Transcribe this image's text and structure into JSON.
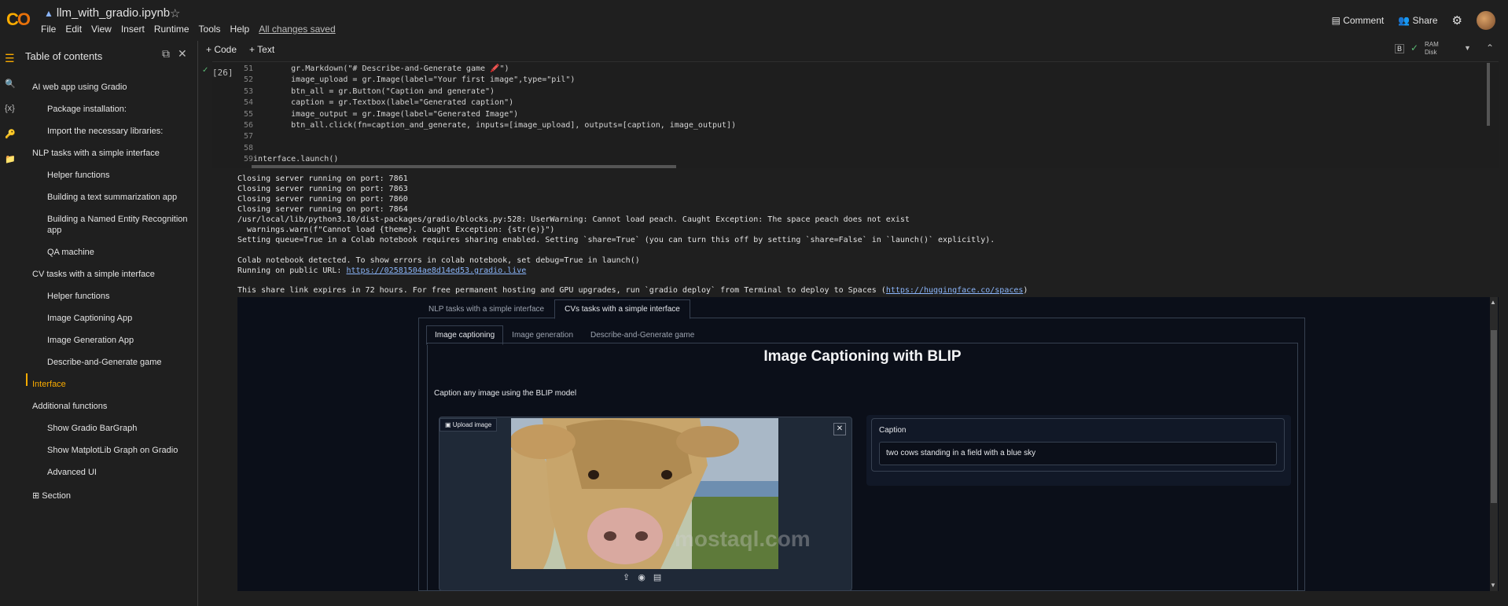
{
  "app": {
    "notebook_title": "llm_with_gradio.ipynb",
    "menu": [
      "File",
      "Edit",
      "View",
      "Insert",
      "Runtime",
      "Tools",
      "Help"
    ],
    "saved_status": "All changes saved",
    "comment_label": "Comment",
    "share_label": "Share"
  },
  "toolbar": {
    "code_label": "+ Code",
    "text_label": "+ Text",
    "ram_label": "RAM",
    "disk_label": "Disk",
    "b_badge": "B"
  },
  "sidebar": {
    "title": "Table of contents",
    "items": [
      {
        "label": "AI web app using Gradio",
        "level": 1
      },
      {
        "label": "Package installation:",
        "level": 2
      },
      {
        "label": "Import the necessary libraries:",
        "level": 2
      },
      {
        "label": "NLP tasks with a simple interface",
        "level": 1
      },
      {
        "label": "Helper functions",
        "level": 2
      },
      {
        "label": "Building a text summarization app",
        "level": 2
      },
      {
        "label": "Building a Named Entity Recognition app",
        "level": 2
      },
      {
        "label": "QA machine",
        "level": 2
      },
      {
        "label": "CV tasks with a simple interface",
        "level": 1
      },
      {
        "label": "Helper functions",
        "level": 2
      },
      {
        "label": "Image Captioning App",
        "level": 2
      },
      {
        "label": "Image Generation App",
        "level": 2
      },
      {
        "label": "Describe-and-Generate game",
        "level": 2
      },
      {
        "label": "Interface",
        "level": 1
      },
      {
        "label": "Additional functions",
        "level": 1
      },
      {
        "label": "Show Gradio BarGraph",
        "level": 2
      },
      {
        "label": "Show MatplotLib Graph on Gradio",
        "level": 2
      },
      {
        "label": "Advanced UI",
        "level": 2
      },
      {
        "label": "Section",
        "level": 1
      }
    ]
  },
  "cell": {
    "exec_count": "[26]",
    "lines": [
      {
        "n": "51",
        "text": "        gr.Markdown(\"# Describe-and-Generate game 🖍️\")"
      },
      {
        "n": "52",
        "text": "        image_upload = gr.Image(label=\"Your first image\",type=\"pil\")"
      },
      {
        "n": "53",
        "text": "        btn_all = gr.Button(\"Caption and generate\")"
      },
      {
        "n": "54",
        "text": "        caption = gr.Textbox(label=\"Generated caption\")"
      },
      {
        "n": "55",
        "text": "        image_output = gr.Image(label=\"Generated Image\")"
      },
      {
        "n": "56",
        "text": "        btn_all.click(fn=caption_and_generate, inputs=[image_upload], outputs=[caption, image_output])"
      },
      {
        "n": "57",
        "text": ""
      },
      {
        "n": "58",
        "text": ""
      },
      {
        "n": "59",
        "text": "interface.launch()"
      }
    ]
  },
  "output": {
    "lines": [
      "Closing server running on port: 7861",
      "Closing server running on port: 7863",
      "Closing server running on port: 7860",
      "Closing server running on port: 7864",
      "/usr/local/lib/python3.10/dist-packages/gradio/blocks.py:528: UserWarning: Cannot load peach. Caught Exception: The space peach does not exist",
      "  warnings.warn(f\"Cannot load {theme}. Caught Exception: {str(e)}\")",
      "Setting queue=True in a Colab notebook requires sharing enabled. Setting `share=True` (you can turn this off by setting `share=False` in `launch()` explicitly).",
      "",
      "Colab notebook detected. To show errors in colab notebook, set debug=True in launch()"
    ],
    "running_prefix": "Running on public URL: ",
    "public_url": "https://02581504ae8d14ed53.gradio.live",
    "share_prefix": "This share link expires in 72 hours. For free permanent hosting and GPU upgrades, run `gradio deploy` from Terminal to deploy to Spaces (",
    "spaces_url": "https://huggingface.co/spaces",
    "share_suffix": ")"
  },
  "gradio": {
    "top_tabs": [
      "NLP tasks with a simple interface",
      "CVs tasks with a simple interface"
    ],
    "sub_tabs": [
      "Image captioning",
      "Image generation",
      "Describe-and-Generate game"
    ],
    "title": "Image Captioning with BLIP",
    "description": "Caption any image using the BLIP model",
    "upload_label": "Upload image",
    "caption_label": "Caption",
    "caption_value": "two cows standing in a field with a blue sky"
  },
  "watermark": "mostaql.com",
  "colors": {
    "accent": "#f9ab00",
    "link": "#8ab4f8",
    "gradio_bg": "#0b0f19"
  }
}
